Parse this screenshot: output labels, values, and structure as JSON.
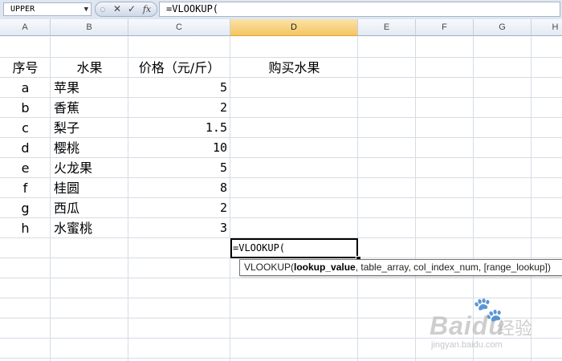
{
  "formula_bar": {
    "name_box": "UPPER",
    "name_box_icon": "chevron-down-icon",
    "cancel_icon": "cancel-x-icon",
    "enter_icon": "checkmark-icon",
    "insert_function_icon": "fx-icon",
    "formula": "=VLOOKUP("
  },
  "columns": [
    "A",
    "B",
    "C",
    "D",
    "E",
    "F",
    "G",
    "H"
  ],
  "active_column": "D",
  "headers": {
    "A": "序号",
    "B": "水果",
    "C": "价格（元/斤）",
    "D": "购买水果"
  },
  "rows": [
    {
      "id": "a",
      "fruit": "苹果",
      "price": "5"
    },
    {
      "id": "b",
      "fruit": "香蕉",
      "price": "2"
    },
    {
      "id": "c",
      "fruit": "梨子",
      "price": "1.5"
    },
    {
      "id": "d",
      "fruit": "樱桃",
      "price": "10"
    },
    {
      "id": "e",
      "fruit": "火龙果",
      "price": "5"
    },
    {
      "id": "f",
      "fruit": "桂圆",
      "price": "8"
    },
    {
      "id": "g",
      "fruit": "西瓜",
      "price": "2"
    },
    {
      "id": "h",
      "fruit": "水蜜桃",
      "price": "3"
    }
  ],
  "editing_cell": {
    "address": "D",
    "text": "=VLOOKUP("
  },
  "tooltip": {
    "function": "VLOOKUP(",
    "current_arg": "lookup_value",
    "rest": ", table_array, col_index_num, [range_lookup])"
  },
  "watermark": {
    "brand": "Baidu",
    "suffix": "经验",
    "url": "jingyan.baidu.com"
  }
}
